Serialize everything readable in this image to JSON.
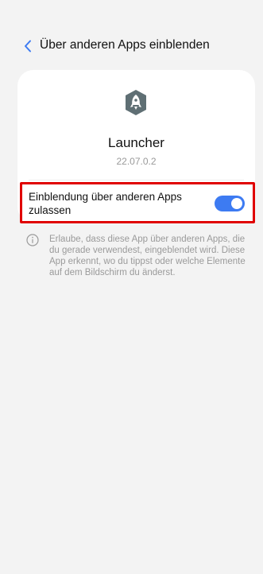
{
  "header": {
    "title": "Über anderen Apps einblenden",
    "back_icon": "chevron-left-icon",
    "accent_color": "#3d7bf2"
  },
  "app_card": {
    "icon": "rocket-shield-icon",
    "name": "Launcher",
    "version": "22.07.0.2"
  },
  "overlay_setting": {
    "label": "Einblendung über anderen Apps zulassen",
    "enabled": true,
    "switch_color": "#3d7bf2",
    "highlight_color": "#e00000"
  },
  "info": {
    "icon": "info-icon",
    "text": "Erlaube, dass diese App über anderen Apps, die du gerade verwendest, eingeblendet wird. Diese App erkennt, wo du tippst oder welche Elemente auf dem Bildschirm du änderst."
  }
}
